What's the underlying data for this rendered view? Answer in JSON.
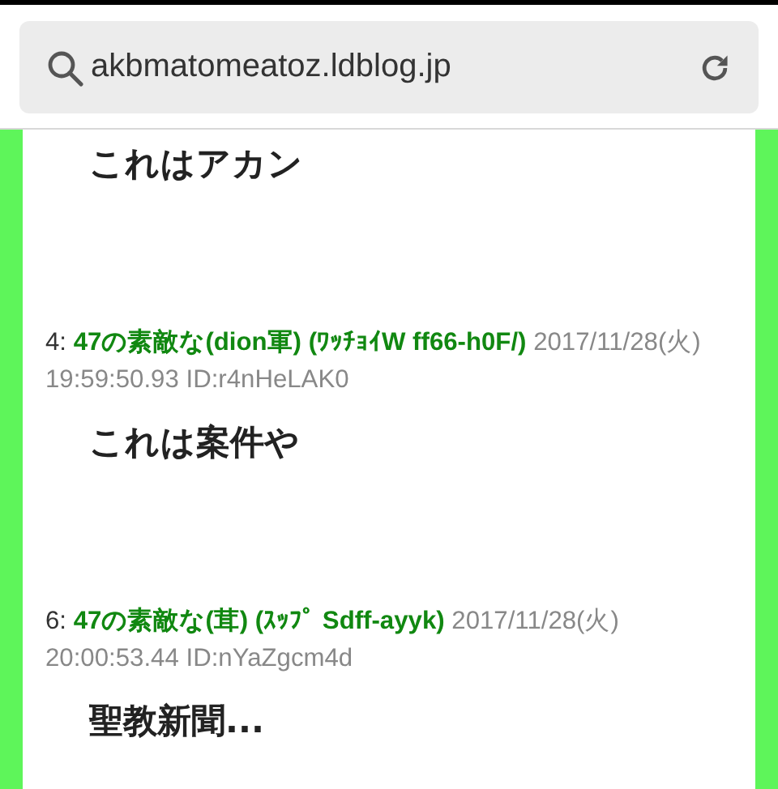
{
  "address_bar": {
    "url": "akbmatomeatoz.ldblog.jp"
  },
  "posts": [
    {
      "body": "これはアカン"
    },
    {
      "number": "4: ",
      "name": "47の素敵な(dion軍) (ﾜｯﾁｮｲW ff66-h0F/)",
      "date": "2017/11/28(火)",
      "time": "19:59:50.93",
      "id": "ID:r4nHeLAK0",
      "body": "これは案件や"
    },
    {
      "number": "6: ",
      "name": "47の素敵な(茸) (ｽｯﾌﾟ Sdff-ayyk)",
      "date": "2017/11/28(火)",
      "time": "20:00:53.44",
      "id": "ID:nYaZgcm4d",
      "body": "聖教新聞..."
    }
  ]
}
